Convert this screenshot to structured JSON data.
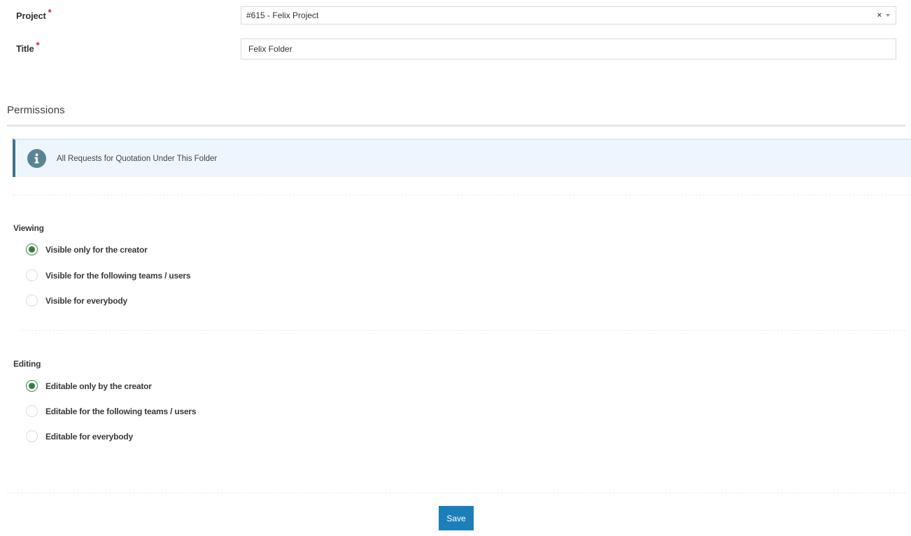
{
  "form": {
    "project": {
      "label": "Project",
      "required_marker": "*",
      "selected_value": "#615 - Felix Project",
      "clear_symbol": "×"
    },
    "title": {
      "label": "Title",
      "required_marker": "*",
      "value": "Felix Folder"
    }
  },
  "permissions": {
    "heading": "Permissions",
    "info_banner": {
      "icon": "info-icon",
      "text": "All Requests for Quotation Under This Folder"
    },
    "viewing": {
      "label": "Viewing",
      "options": [
        {
          "label": "Visible only for the creator",
          "checked": true
        },
        {
          "label": "Visible for the following teams / users",
          "checked": false
        },
        {
          "label": "Visible for everybody",
          "checked": false
        }
      ]
    },
    "editing": {
      "label": "Editing",
      "options": [
        {
          "label": "Editable only by the creator",
          "checked": true
        },
        {
          "label": "Editable for the following teams / users",
          "checked": false
        },
        {
          "label": "Editable for everybody",
          "checked": false
        }
      ]
    }
  },
  "actions": {
    "save_label": "Save"
  },
  "colors": {
    "accent_blue": "#1d7fba",
    "radio_green": "#3a7a46",
    "required_red": "#c0262d",
    "info_bg": "#eef6fd",
    "info_border": "#3d7487"
  }
}
